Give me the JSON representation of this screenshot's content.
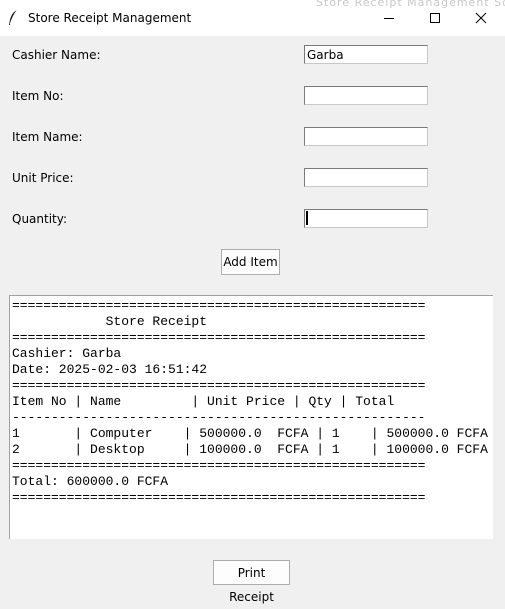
{
  "window": {
    "title": "Store Receipt Management",
    "ghost_title": "Store Receipt Management Solu"
  },
  "form": {
    "cashier_label": "Cashier Name:",
    "cashier_value": "Garba",
    "item_no_label": "Item No:",
    "item_no_value": "",
    "item_name_label": "Item Name:",
    "item_name_value": "",
    "unit_price_label": "Unit Price:",
    "unit_price_value": "",
    "quantity_label": "Quantity:",
    "quantity_value": "",
    "add_button": "Add Item"
  },
  "receipt": {
    "separator": "=====================================================",
    "dash_separator": "-----------------------------------------------------",
    "title_line": "            Store Receipt",
    "cashier_line": "Cashier: Garba",
    "date_line": "Date: 2025-02-03 16:51:42",
    "header_line": "Item No | Name         | Unit Price | Qty | Total",
    "rows": [
      "1       | Computer    | 500000.0  FCFA | 1    | 500000.0 FCFA",
      "2       | Desktop     | 100000.0  FCFA | 1    | 100000.0 FCFA"
    ],
    "total_line": "Total: 600000.0 FCFA"
  },
  "print_button": "Print Receipt",
  "icons": {
    "app": "feather-icon",
    "minimize": "minimize-icon",
    "maximize": "maximize-icon",
    "close": "close-icon"
  }
}
